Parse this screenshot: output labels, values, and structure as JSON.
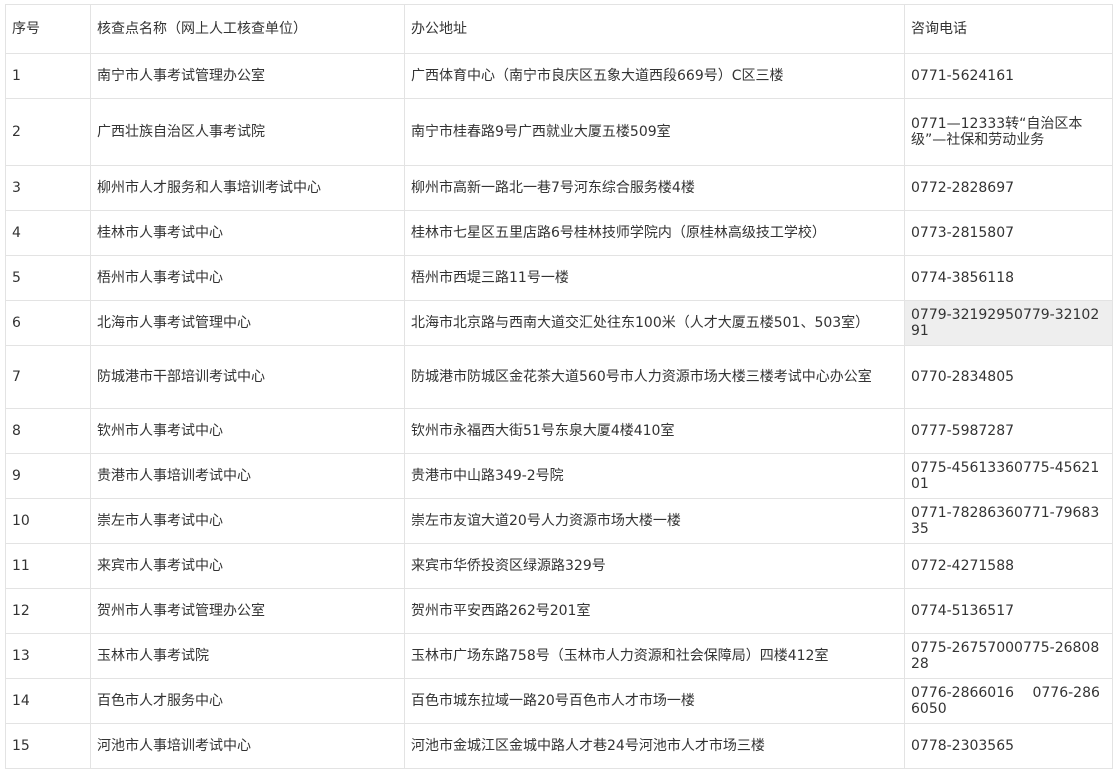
{
  "table": {
    "headers": [
      "序号",
      "核查点名称（网上人工核查单位）",
      "办公地址",
      "咨询电话"
    ],
    "rows": [
      {
        "no": "1",
        "name": "南宁市人事考试管理办公室",
        "address": "广西体育中心（南宁市良庆区五象大道西段669号）C区三楼",
        "phone": "0771-5624161"
      },
      {
        "no": "2",
        "name": "广西壮族自治区人事考试院",
        "address": "南宁市桂春路9号广西就业大厦五楼509室",
        "phone": "0771—12333转“自治区本级”—社保和劳动业务"
      },
      {
        "no": "3",
        "name": "柳州市人才服务和人事培训考试中心",
        "address": "柳州市高新一路北一巷7号河东综合服务楼4楼",
        "phone": "0772-2828697"
      },
      {
        "no": "4",
        "name": "桂林市人事考试中心",
        "address": "桂林市七星区五里店路6号桂林技师学院内（原桂林高级技工学校）",
        "phone": "0773-2815807"
      },
      {
        "no": "5",
        "name": "梧州市人事考试中心",
        "address": "梧州市西堤三路11号一楼",
        "phone": "0774-3856118"
      },
      {
        "no": "6",
        "name": "北海市人事考试管理中心",
        "address": "北海市北京路与西南大道交汇处往东100米（人才大厦五楼501、503室）",
        "phone": "0779-32192950779-3210291"
      },
      {
        "no": "7",
        "name": "防城港市干部培训考试中心",
        "address": "防城港市防城区金花茶大道560号市人力资源市场大楼三楼考试中心办公室",
        "phone": "0770-2834805"
      },
      {
        "no": "8",
        "name": "钦州市人事考试中心",
        "address": "钦州市永福西大街51号东泉大厦4楼410室",
        "phone": "0777-5987287"
      },
      {
        "no": "9",
        "name": "贵港市人事培训考试中心",
        "address": "贵港市中山路349-2号院",
        "phone": "0775-45613360775-4562101"
      },
      {
        "no": "10",
        "name": "崇左市人事考试中心",
        "address": "崇左市友谊大道20号人力资源市场大楼一楼",
        "phone": "0771-78286360771-7968335"
      },
      {
        "no": "11",
        "name": "来宾市人事考试中心",
        "address": "来宾市华侨投资区绿源路329号",
        "phone": "0772-4271588"
      },
      {
        "no": "12",
        "name": "贺州市人事考试管理办公室",
        "address": "贺州市平安西路262号201室",
        "phone": "0774-5136517"
      },
      {
        "no": "13",
        "name": "玉林市人事考试院",
        "address": "玉林市广场东路758号（玉林市人力资源和社会保障局）四楼412室",
        "phone": "0775-26757000775-2680828"
      },
      {
        "no": "14",
        "name": "百色市人才服务中心",
        "address": "百色市城东拉域一路20号百色市人才市场一楼",
        "phone": "0776-2866016　 0776-2866050"
      },
      {
        "no": "15",
        "name": "河池市人事培训考试中心",
        "address": "河池市金城江区金城中路人才巷24号河池市人才市场三楼",
        "phone": "0778-2303565"
      }
    ]
  }
}
